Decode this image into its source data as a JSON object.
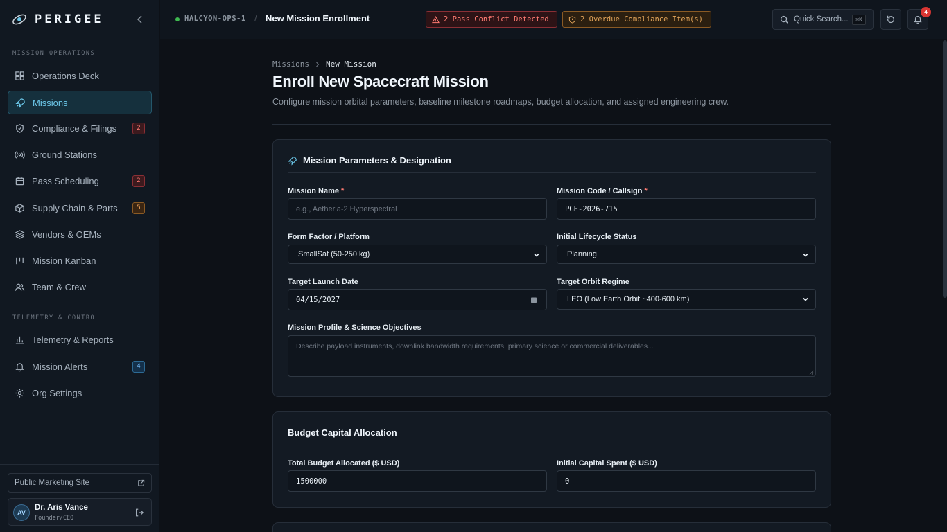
{
  "brand": {
    "name": "PERIGEE"
  },
  "sidebar": {
    "sections": [
      {
        "label": "MISSION OPERATIONS"
      },
      {
        "label": "TELEMETRY & CONTROL"
      }
    ],
    "items": [
      {
        "label": "Operations Deck",
        "icon": "grid-icon"
      },
      {
        "label": "Missions",
        "icon": "rocket-icon",
        "active": true
      },
      {
        "label": "Compliance & Filings",
        "icon": "shield-check-icon",
        "badge": "2"
      },
      {
        "label": "Ground Stations",
        "icon": "radio-tower-icon"
      },
      {
        "label": "Pass Scheduling",
        "icon": "calendar-icon",
        "badge": "2"
      },
      {
        "label": "Supply Chain & Parts",
        "icon": "package-icon",
        "badge": "5"
      },
      {
        "label": "Vendors & OEMs",
        "icon": "layers-icon"
      },
      {
        "label": "Mission Kanban",
        "icon": "kanban-icon"
      },
      {
        "label": "Team & Crew",
        "icon": "users-icon"
      },
      {
        "label": "Telemetry & Reports",
        "icon": "bar-chart-icon"
      },
      {
        "label": "Mission Alerts",
        "icon": "bell-icon",
        "badge": "4"
      },
      {
        "label": "Org Settings",
        "icon": "gear-icon"
      }
    ],
    "footer": {
      "marketing_link": "Public Marketing Site",
      "user": {
        "initials": "AV",
        "name": "Dr. Aris Vance",
        "role": "Founder/CEO"
      }
    }
  },
  "topbar": {
    "org": "HALCYON-OPS-1",
    "separator": "/",
    "title": "New Mission Enrollment",
    "alerts": [
      {
        "text": "2 Pass Conflict Detected",
        "color": "#ff7b72"
      },
      {
        "text": "2 Overdue Compliance Item(s)",
        "color": "#e3a55a"
      }
    ],
    "search": {
      "placeholder": "Quick Search...",
      "shortcut": "⌘K"
    },
    "notifications": {
      "count": "4"
    }
  },
  "page": {
    "breadcrumb": [
      "Missions",
      "New Mission"
    ],
    "title": "Enroll New Spacecraft Mission",
    "subtitle": "Configure mission orbital parameters, baseline milestone roadmaps, budget allocation, and assigned engineering crew."
  },
  "mission_card": {
    "title": "Mission Parameters & Designation",
    "fields": {
      "mission_name": {
        "label": "Mission Name",
        "required": "*",
        "value": "",
        "placeholder": "e.g., Aetheria-2 Hyperspectral"
      },
      "mission_code": {
        "label": "Mission Code / Callsign",
        "required": "*",
        "value": "PGE-2026-715"
      },
      "form_factor": {
        "label": "Form Factor / Platform",
        "value": "SmallSat (50-250 kg)"
      },
      "lifecycle": {
        "label": "Initial Lifecycle Status",
        "value": "Planning"
      },
      "launch_date": {
        "label": "Target Launch Date",
        "value": "04/15/2027"
      },
      "orbit": {
        "label": "Target Orbit Regime",
        "value": "LEO (Low Earth Orbit ~400-600 km)"
      },
      "objectives": {
        "label": "Mission Profile & Science Objectives",
        "value": "",
        "placeholder": "Describe payload instruments, downlink bandwidth requirements, primary science or commercial deliverables..."
      }
    }
  },
  "budget_card": {
    "title": "Budget Capital Allocation",
    "fields": {
      "total_budget": {
        "label": "Total Budget Allocated ($ USD)",
        "value": "1500000"
      },
      "capital_spent": {
        "label": "Initial Capital Spent ($ USD)",
        "value": "0"
      }
    }
  },
  "colors": {
    "accent": "#6cc8ea",
    "background": "#0d1117",
    "danger": "#ff7b72",
    "warning": "#e3a55a"
  }
}
